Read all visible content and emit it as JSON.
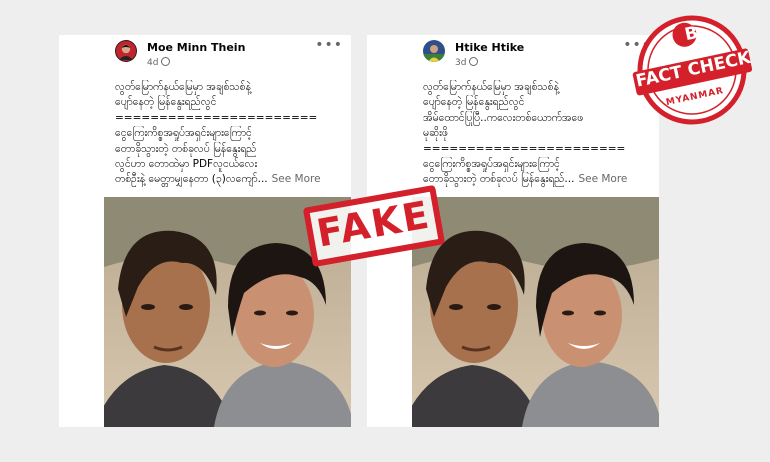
{
  "posts": [
    {
      "author": "Moe Minn Thein",
      "time": "4d",
      "more_label": "•••",
      "lines": [
        "လွတ်မြောက်နယ်မြေမှာ အချစ်သစ်နဲ့",
        "ပျော်နေတဲ့ မြန်နွေးရည်လွင်",
        "=======================",
        "ငွေကြေးကိစ္စအရှုပ်အရှင်းများကြောင့်",
        "တောခိုသွားတဲ့ တစ်ခုလပ် မြန်နွေးရည်",
        "လွင်ဟာ တောထဲမှာ PDFလူငယ်လေး",
        "တစ်ဦးနဲ့ မေတ္တာမျှနေတာ (၃)လကျော်..."
      ],
      "see_more": "See More"
    },
    {
      "author": "Htike Htike",
      "time": "3d",
      "more_label": "•••",
      "lines": [
        "လွတ်မြောက်နယ်မြေမှာ အချစ်သစ်နဲ့",
        "ပျော်နေတဲ့ မြန်နွေးရည်လွင်",
        "အိမ်ထောင်ပြုပြီ..ကလေးတစ်ယောက်အဖေ",
        "မုဆိုးဖို",
        "=======================",
        "ငွေကြေးကိစ္စအရှုပ်အရှင်းများကြောင့်",
        "တောခိုသွားတဲ့ တစ်ခုလပ် မြန်နွေးရည်..."
      ],
      "see_more": "See More"
    }
  ],
  "stamp": {
    "text": "FAKE",
    "color": "#d3202a"
  },
  "badge": {
    "letter": "B",
    "line1": "FACT",
    "line2": "CHECK",
    "line3": "MYANMAR",
    "color": "#d3202a"
  }
}
